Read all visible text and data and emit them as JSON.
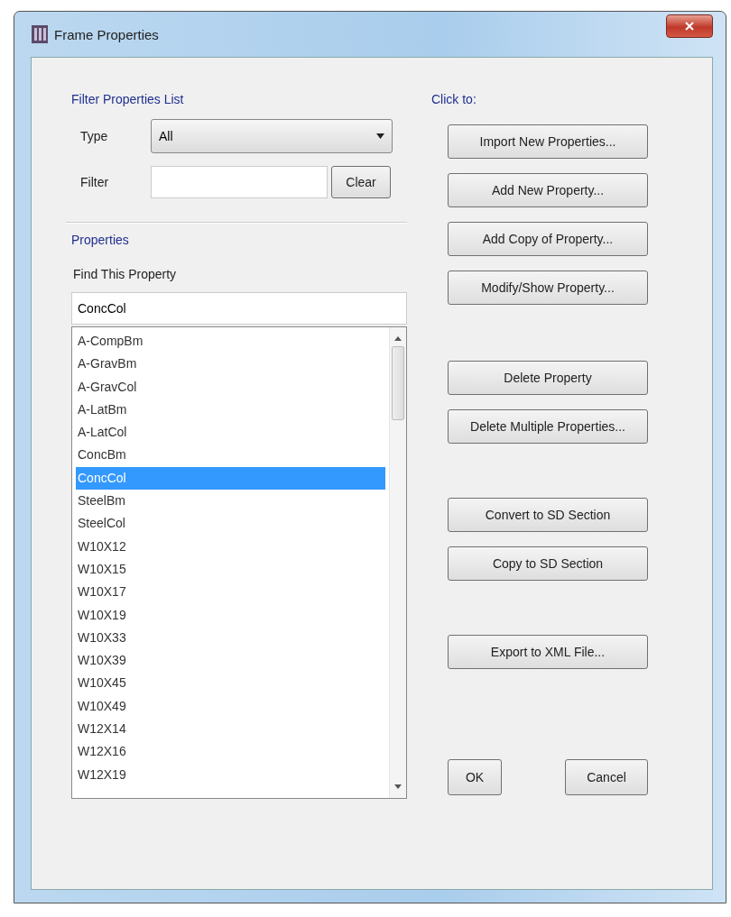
{
  "window": {
    "title": "Frame Properties"
  },
  "filter": {
    "heading": "Filter Properties List",
    "type_label": "Type",
    "type_value": "All",
    "filter_label": "Filter",
    "clear_button": "Clear"
  },
  "properties": {
    "heading": "Properties",
    "find_label": "Find This Property",
    "find_value": "ConcCol",
    "items": [
      {
        "label": "A-CompBm",
        "selected": false
      },
      {
        "label": "A-GravBm",
        "selected": false
      },
      {
        "label": "A-GravCol",
        "selected": false
      },
      {
        "label": "A-LatBm",
        "selected": false
      },
      {
        "label": "A-LatCol",
        "selected": false
      },
      {
        "label": "ConcBm",
        "selected": false
      },
      {
        "label": "ConcCol",
        "selected": true
      },
      {
        "label": "SteelBm",
        "selected": false
      },
      {
        "label": "SteelCol",
        "selected": false
      },
      {
        "label": "W10X12",
        "selected": false
      },
      {
        "label": "W10X15",
        "selected": false
      },
      {
        "label": "W10X17",
        "selected": false
      },
      {
        "label": "W10X19",
        "selected": false
      },
      {
        "label": "W10X33",
        "selected": false
      },
      {
        "label": "W10X39",
        "selected": false
      },
      {
        "label": "W10X45",
        "selected": false
      },
      {
        "label": "W10X49",
        "selected": false
      },
      {
        "label": "W12X14",
        "selected": false
      },
      {
        "label": "W12X16",
        "selected": false
      },
      {
        "label": "W12X19",
        "selected": false
      }
    ]
  },
  "actions": {
    "heading": "Click to:",
    "groups": [
      [
        "Import New Properties...",
        "Add New Property...",
        "Add Copy of Property...",
        "Modify/Show Property..."
      ],
      [
        "Delete Property",
        "Delete Multiple Properties..."
      ],
      [
        "Convert to SD Section",
        "Copy to SD Section"
      ],
      [
        "Export to XML File..."
      ]
    ]
  },
  "buttons": [
    "OK",
    "Cancel"
  ]
}
